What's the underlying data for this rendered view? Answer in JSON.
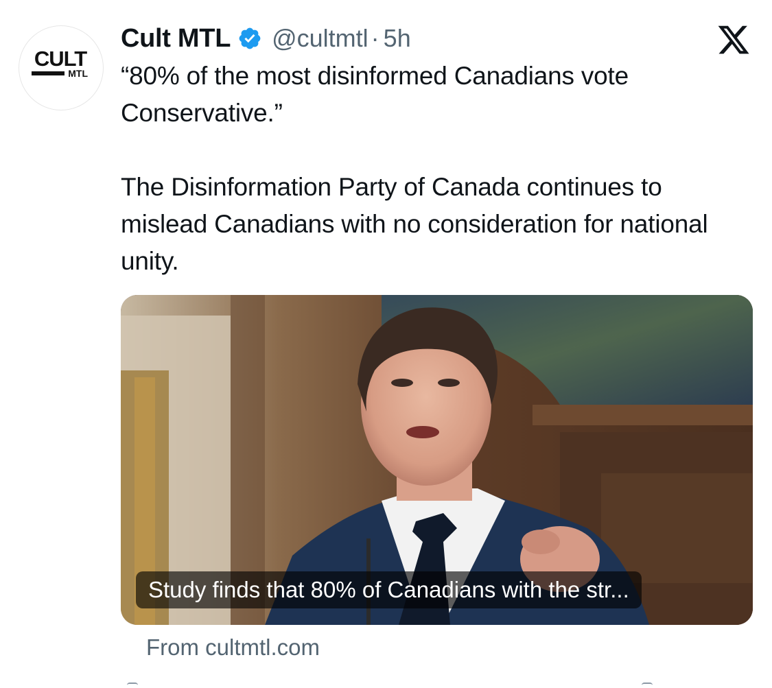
{
  "author": {
    "avatar_logo_text": "CULT",
    "avatar_logo_subtext": "MTL",
    "display_name": "Cult MTL",
    "verified_icon": "verified-badge-icon",
    "handle": "@cultmtl",
    "separator": "·",
    "time": "5h"
  },
  "platform_icon": "x-logo-icon",
  "tweet": {
    "paragraph1": "“80% of the most disinformed Canadians vote Conservative.”",
    "paragraph2": "The Disinformation Party of Canada continues to mislead Canadians with no consideration for national unity."
  },
  "card": {
    "caption": "Study finds that 80% of Canadians with the str...",
    "source": "From cultmtl.com"
  },
  "colors": {
    "text_primary": "#0f1419",
    "text_secondary": "#536471",
    "verified_blue": "#1d9bf0"
  }
}
